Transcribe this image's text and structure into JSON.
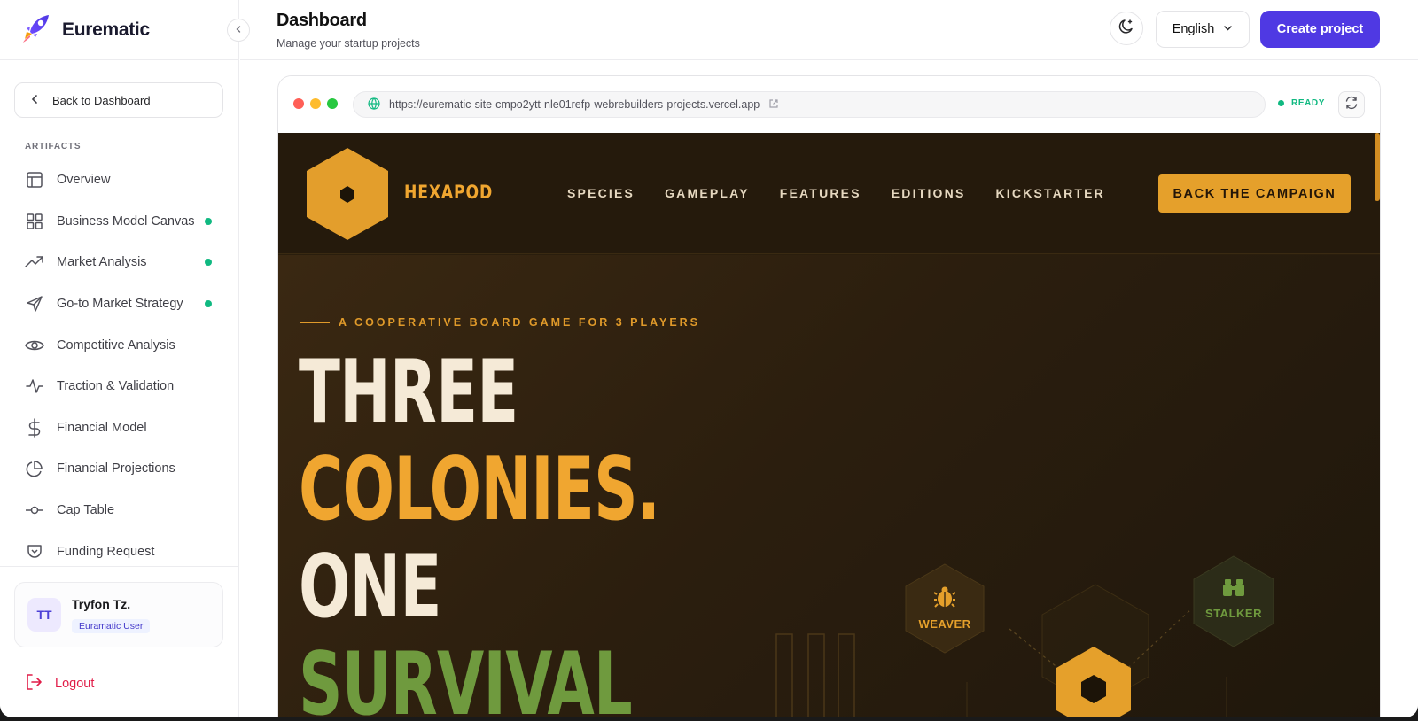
{
  "sidebar": {
    "brand": "Eurematic",
    "back_label": "Back to Dashboard",
    "section_label": "ARTIFACTS",
    "items": [
      {
        "label": "Overview",
        "icon": "layout-icon",
        "status": false
      },
      {
        "label": "Business Model Canvas",
        "icon": "grid-icon",
        "status": true
      },
      {
        "label": "Market Analysis",
        "icon": "trending-up-icon",
        "status": true
      },
      {
        "label": "Go-to Market Strategy",
        "icon": "send-icon",
        "status": true
      },
      {
        "label": "Competitive Analysis",
        "icon": "eye-icon",
        "status": false
      },
      {
        "label": "Traction & Validation",
        "icon": "activity-icon",
        "status": false
      },
      {
        "label": "Financial Model",
        "icon": "dollar-icon",
        "status": false
      },
      {
        "label": "Financial Projections",
        "icon": "pie-chart-icon",
        "status": false
      },
      {
        "label": "Cap Table",
        "icon": "commit-icon",
        "status": false
      },
      {
        "label": "Funding Request",
        "icon": "pocket-icon",
        "status": false
      }
    ],
    "user": {
      "initials": "TT",
      "name": "Tryfon Tz.",
      "role": "Euramatic User"
    },
    "logout_label": "Logout"
  },
  "header": {
    "title": "Dashboard",
    "subtitle": "Manage your startup projects",
    "language": "English",
    "create_label": "Create project"
  },
  "preview": {
    "url": "https://eurematic-site-cmpo2ytt-nle01refp-webrebuilders-projects.vercel.app",
    "status": "READY"
  },
  "site": {
    "brand": "HEXAPOD",
    "nav": [
      "SPECIES",
      "GAMEPLAY",
      "FEATURES",
      "EDITIONS",
      "KICKSTARTER"
    ],
    "cta": "BACK THE CAMPAIGN",
    "eyebrow": "A COOPERATIVE BOARD GAME FOR 3 PLAYERS",
    "headline": [
      "THREE",
      "COLONIES.",
      "ONE",
      "SURVIVAL"
    ],
    "tokens": [
      {
        "label": "WEAVER",
        "icon": "beetle-icon"
      },
      {
        "label": "STALKER",
        "icon": "binoculars-icon"
      }
    ]
  },
  "colors": {
    "accent": "#4f39e3",
    "ready": "#10b981",
    "status_dot": "#10b981",
    "logout": "#e11d48",
    "site_gold": "#f0a630",
    "site_green": "#6f9a3e",
    "site_cream": "#f5ead7"
  }
}
